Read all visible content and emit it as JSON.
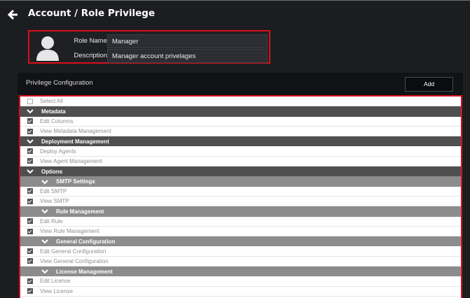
{
  "header": {
    "title": "Account / Role Privilege"
  },
  "role": {
    "name_label": "Role Name",
    "name_value": "Manager",
    "description_label": "Description",
    "description_value": "Manager account privelages"
  },
  "privileges": {
    "title": "Privilege Configuration",
    "add_label": "Add",
    "select_all": "Select All",
    "metadata": {
      "label": "Metadata",
      "edit_columns": "Edit Columns",
      "view_metadata": "View Metadata Management"
    },
    "deployment": {
      "label": "Deployment Management",
      "deploy_agents": "Deploy Agents",
      "view_agent": "View Agent Management"
    },
    "options": {
      "label": "Options",
      "smtp": {
        "label": "SMTP Settings",
        "edit": "Edit SMTP",
        "view": "View SMTP"
      },
      "rule": {
        "label": "Rule Management",
        "edit": "Edit Rule",
        "view": "View Rule Management"
      },
      "general": {
        "label": "General Configuration",
        "edit": "Edit General Configuration",
        "view": "View General Configuration"
      },
      "license": {
        "label": "License Management",
        "edit": "Edit License",
        "view": "View License"
      }
    }
  },
  "colors": {
    "accent_red": "#d8101c",
    "background": "#1c1d21",
    "group_bg": "#4f4f4f",
    "subgroup_bg": "#8c8c8c"
  }
}
